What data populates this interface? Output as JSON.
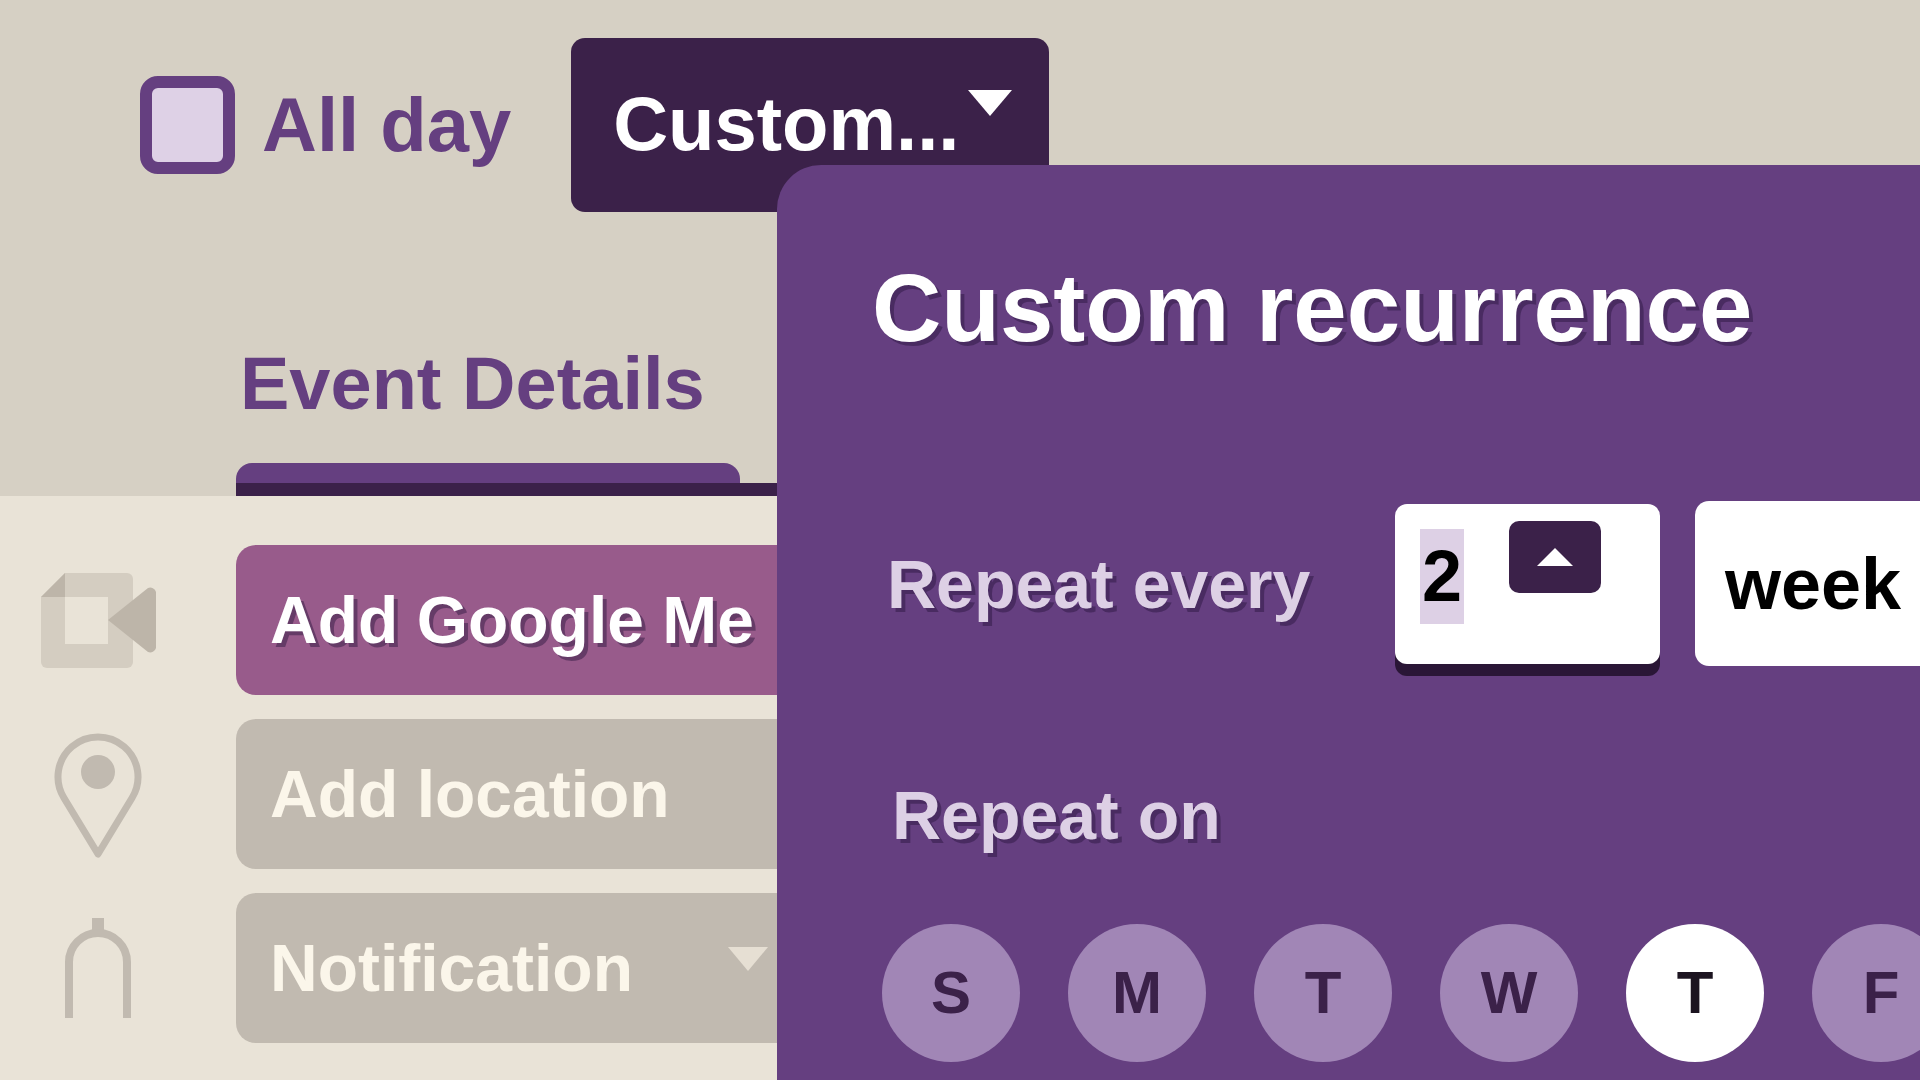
{
  "all_day": {
    "label": "All day",
    "checked": false
  },
  "recurrence_dropdown": {
    "value": "Custom..."
  },
  "tabs": [
    {
      "label": "Event Details",
      "selected": true
    }
  ],
  "event_actions": [
    {
      "label": "Add Google Me",
      "kind": "video",
      "active": true
    },
    {
      "label": "Add location",
      "kind": "location",
      "active": false
    },
    {
      "label": "Notification",
      "kind": "bell",
      "active": false
    }
  ],
  "dialog": {
    "title": "Custom recurrence",
    "repeat_every": {
      "label": "Repeat every",
      "value": "2",
      "unit": "week"
    },
    "repeat_on": {
      "label": "Repeat on",
      "days": [
        {
          "label": "S",
          "selected": false
        },
        {
          "label": "M",
          "selected": false
        },
        {
          "label": "T",
          "selected": false
        },
        {
          "label": "W",
          "selected": false
        },
        {
          "label": "T",
          "selected": true
        },
        {
          "label": "F",
          "selected": false
        }
      ]
    }
  }
}
